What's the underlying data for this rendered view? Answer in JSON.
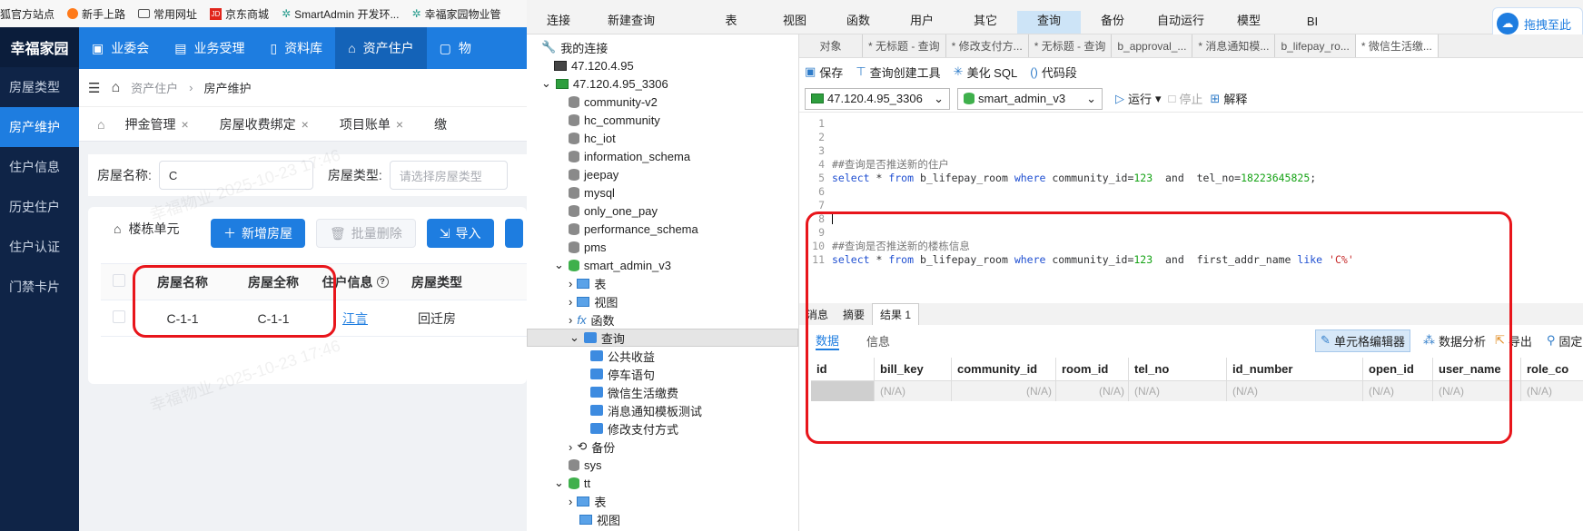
{
  "browser": {
    "bookmarks": [
      "狐官方站点",
      "新手上路",
      "常用网址",
      "京东商城",
      "SmartAdmin 开发环...",
      "幸福家园物业管"
    ]
  },
  "app": {
    "logo": "幸福家园",
    "side_items": [
      "房屋类型",
      "房产维护",
      "住户信息",
      "历史住户",
      "住户认证",
      "门禁卡片"
    ],
    "top_nav": [
      "业委会",
      "业务受理",
      "资料库",
      "资产住户",
      "物"
    ],
    "breadcrumb": [
      "资产住户",
      "房产维护"
    ],
    "tabs": [
      "押金管理",
      "房屋收费绑定",
      "项目账单",
      "缴"
    ],
    "filter": {
      "name_label": "房屋名称:",
      "name_value": "C",
      "type_label": "房屋类型:",
      "type_placeholder": "请选择房屋类型"
    },
    "tree_label": "楼栋单元",
    "buttons": {
      "add": "新增房屋",
      "batch_delete": "批量删除",
      "import": "导入"
    },
    "table": {
      "headers": [
        "房屋名称",
        "房屋全称",
        "住户信息",
        "房屋类型"
      ],
      "rows": [
        [
          "C-1-1",
          "C-1-1",
          "江言",
          "回迁房"
        ]
      ]
    },
    "watermark": "幸福物业 2025-10-23 17:46"
  },
  "navicat": {
    "ribbon": [
      "连接",
      "新建查询",
      "表",
      "视图",
      "函数",
      "用户",
      "其它",
      "查询",
      "备份",
      "自动运行",
      "模型",
      "BI"
    ],
    "hint": "拖拽至此",
    "tree": {
      "root": "我的连接",
      "conn1": "47.120.4.95",
      "conn2": "47.120.4.95_3306",
      "dbs": [
        "community-v2",
        "hc_community",
        "hc_iot",
        "information_schema",
        "jeepay",
        "mysql",
        "only_one_pay",
        "performance_schema",
        "pms"
      ],
      "open_db": "smart_admin_v3",
      "open_children": [
        "表",
        "视图",
        "函数",
        "查询"
      ],
      "queries": [
        "公共收益",
        "停车语句",
        "微信生活缴费",
        "消息通知模板测试",
        "修改支付方式"
      ],
      "backup": "备份",
      "after": [
        "sys",
        "tt"
      ],
      "tt_children": [
        "表",
        "视图"
      ]
    },
    "editor_tabs": [
      "对象",
      "* 无标题 - 查询",
      "* 修改支付方...",
      "* 无标题 - 查询",
      "b_approval_...",
      "* 消息通知模...",
      "b_lifepay_ro...",
      "* 微信生活缴..."
    ],
    "toolbar": [
      "保存",
      "查询创建工具",
      "美化 SQL",
      "代码段"
    ],
    "connection": "47.120.4.95_3306",
    "database": "smart_admin_v3",
    "run": "运行",
    "stop": "停止",
    "explain": "解释",
    "code": {
      "comment1": "##查询是否推送新的住户",
      "sql1": [
        "select",
        " * ",
        "from",
        " b_lifepay_room ",
        "where",
        " community_id=",
        "123",
        "  and  tel_no=",
        "18223645825",
        ";"
      ],
      "comment2": "##查询是否推送新的楼栋信息",
      "sql2": [
        "select",
        " * ",
        "from",
        " b_lifepay_room ",
        "where",
        " community_id=",
        "123",
        "  and  first_addr_name ",
        "like",
        " ",
        "'C%'"
      ]
    },
    "result_tabs": [
      "消息",
      "摘要",
      "结果 1"
    ],
    "result_subtabs": [
      "数据",
      "信息"
    ],
    "result_tools": [
      "单元格编辑器",
      "数据分析",
      "导出",
      "固定"
    ],
    "columns": [
      "id",
      "bill_key",
      "community_id",
      "room_id",
      "tel_no",
      "id_number",
      "open_id",
      "user_name",
      "role_co"
    ],
    "row": [
      "",
      "(N/A)",
      "(N/A)",
      "(N/A)",
      "(N/A)",
      "(N/A)",
      "(N/A)",
      "(N/A)",
      "(N/A)"
    ],
    "line_numbers": [
      "1",
      "2",
      "3",
      "4",
      "5",
      "6",
      "7",
      "8",
      "9",
      "10",
      "11"
    ]
  }
}
